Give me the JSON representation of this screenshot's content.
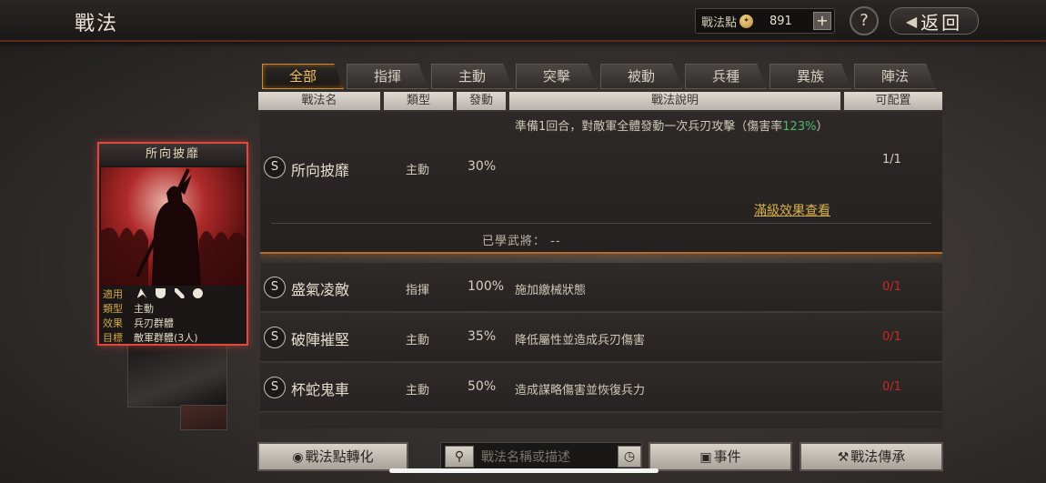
{
  "header": {
    "title": "戰法",
    "points_label": "戰法點",
    "points_value": "891",
    "plus_label": "+",
    "help_label": "?",
    "back_label": "返回"
  },
  "tabs": [
    {
      "label": "全部",
      "active": true
    },
    {
      "label": "指揮"
    },
    {
      "label": "主動"
    },
    {
      "label": "突擊"
    },
    {
      "label": "被動"
    },
    {
      "label": "兵種"
    },
    {
      "label": "異族"
    },
    {
      "label": "陣法"
    }
  ],
  "columns": [
    "戰法名",
    "類型",
    "發動",
    "戰法說明",
    "可配置"
  ],
  "selected_skill": {
    "grade": "S",
    "name": "所向披靡",
    "type": "主動",
    "rate": "30%",
    "desc_part1": "準備1回合，對敵軍全體發動一次兵刃攻擊（傷害率",
    "desc_highlight": "123%",
    "desc_part2": "）",
    "count": "1/1",
    "full_effect_link": "滿級效果查看",
    "learned_label": "已學武將：",
    "learned_value": "--"
  },
  "skills": [
    {
      "grade": "S",
      "name": "盛氣凌敵",
      "type": "指揮",
      "rate": "100%",
      "desc": "施加繳械狀態",
      "count": "0/1"
    },
    {
      "grade": "S",
      "name": "破陣摧堅",
      "type": "主動",
      "rate": "35%",
      "desc": "降低屬性並造成兵刃傷害",
      "count": "0/1"
    },
    {
      "grade": "S",
      "name": "杯蛇鬼車",
      "type": "主動",
      "rate": "50%",
      "desc": "造成謀略傷害並恢復兵力",
      "count": "0/1"
    }
  ],
  "card": {
    "title": "所向披靡",
    "apply_label": "適用",
    "type_label": "類型",
    "type_value": "主動",
    "effect_label": "效果",
    "effect_value": "兵刃群體",
    "target_label": "目標",
    "target_value": "敵軍群體(3人)"
  },
  "footer": {
    "convert_label": "戰法點轉化",
    "search_placeholder": "戰法名稱或描述",
    "event_label": "事件",
    "inherit_label": "戰法傳承"
  },
  "colors": {
    "accent": "#d0892e",
    "highlight_green": "#4fb868",
    "unavailable_red": "#c82a1e",
    "link_gold": "#d9b04a"
  }
}
